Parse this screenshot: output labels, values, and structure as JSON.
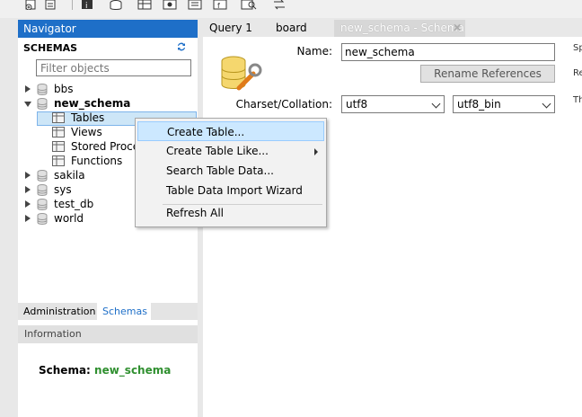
{
  "toolbar": {
    "icons": [
      "new-sql-icon",
      "open-sql-icon",
      "info-icon",
      "create-schema-icon",
      "create-table-icon",
      "create-view-icon",
      "create-procedure-icon",
      "create-function-icon",
      "search-table-icon",
      "reconnect-icon"
    ]
  },
  "navigator": {
    "title": "Navigator",
    "schemas_label": "SCHEMAS",
    "filter_placeholder": "Filter objects",
    "schemas": [
      {
        "name": "bbs",
        "expanded": false
      },
      {
        "name": "new_schema",
        "expanded": true,
        "children": [
          "Tables",
          "Views",
          "Stored Procedures",
          "Functions"
        ]
      },
      {
        "name": "sakila",
        "expanded": false
      },
      {
        "name": "sys",
        "expanded": false
      },
      {
        "name": "test_db",
        "expanded": false
      },
      {
        "name": "world",
        "expanded": false
      }
    ],
    "tabs": [
      "Administration",
      "Schemas"
    ],
    "active_tab": "Schemas",
    "info_title": "Information",
    "info_schema_label": "Schema:",
    "info_schema_value": "new_schema"
  },
  "editor": {
    "tabs": [
      "Query 1",
      "board",
      "new_schema - Schema"
    ],
    "active_tab": "new_schema - Schema",
    "name_label": "Name:",
    "name_value": "new_schema",
    "rename_button": "Rename References",
    "charset_label": "Charset/Collation:",
    "charset_value": "utf8",
    "collation_value": "utf8_bin",
    "side_texts": [
      "Sp",
      "Re",
      "Th"
    ]
  },
  "context_menu": {
    "items": [
      "Create Table...",
      "Create Table Like...",
      "Search Table Data...",
      "Table Data Import Wizard",
      "Refresh All"
    ],
    "highlighted": "Create Table..."
  },
  "colors": {
    "accent": "#1e6fc8",
    "selection": "#cde6f7",
    "schema_green": "#2f8f2f"
  }
}
